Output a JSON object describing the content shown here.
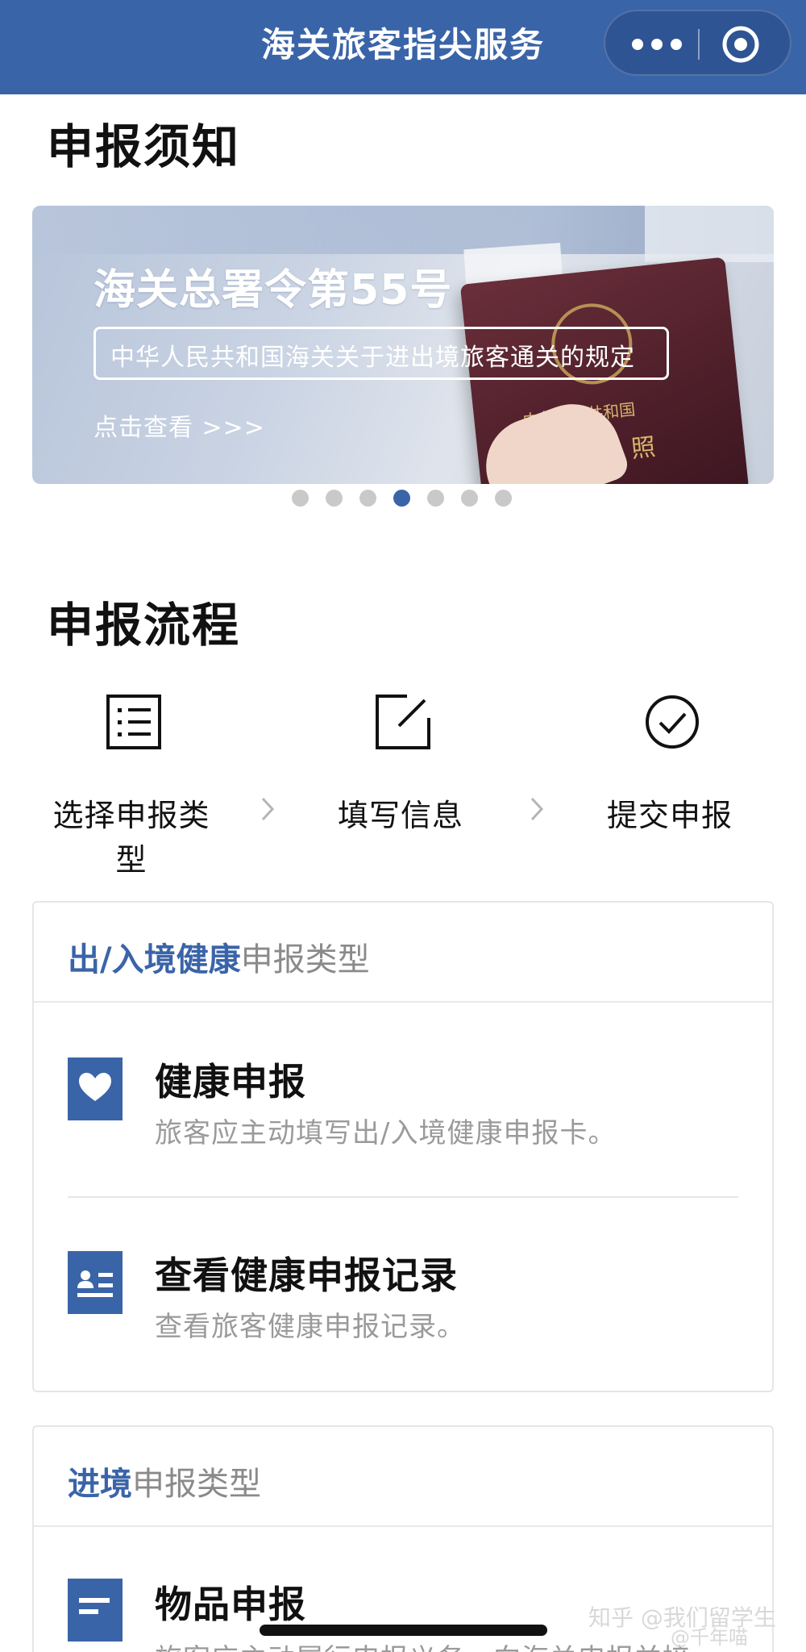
{
  "nav": {
    "title": "海关旅客指尖服务",
    "more_icon": "more-dots-icon",
    "close_icon": "target-circle-icon"
  },
  "notice": {
    "heading": "申报须知",
    "banner": {
      "headline": "海关总署令第55号",
      "subtitle": "中华人民共和国海关关于进出境旅客通关的规定",
      "link": "点击查看 >>>",
      "passport_text1": "中华人民共和国",
      "passport_text2": "照"
    },
    "carousel": {
      "count": 7,
      "active_index": 3
    }
  },
  "process": {
    "heading": "申报流程",
    "steps": [
      {
        "label": "选择申报类型",
        "icon": "list-icon"
      },
      {
        "label": "填写信息",
        "icon": "edit-icon"
      },
      {
        "label": "提交申报",
        "icon": "check-circle-icon"
      }
    ]
  },
  "health_card": {
    "highlight": "出/入境健康",
    "rest": "申报类型",
    "items": [
      {
        "title": "健康申报",
        "desc": "旅客应主动填写出/入境健康申报卡。",
        "icon": "heart-icon"
      },
      {
        "title": "查看健康申报记录",
        "desc": "查看旅客健康申报记录。",
        "icon": "person-list-icon"
      }
    ]
  },
  "entry_card": {
    "highlight": "进境",
    "rest": "申报类型",
    "items": [
      {
        "title": "物品申报",
        "desc": "旅客应主动履行申报义务，向海关申报并接",
        "icon": "document-icon"
      }
    ]
  },
  "watermark": {
    "line1": "知乎 @我们留学生",
    "line2": "@千年喵"
  },
  "colors": {
    "brand": "#3a64a8",
    "text": "#111111",
    "muted": "#9a9a9a"
  }
}
